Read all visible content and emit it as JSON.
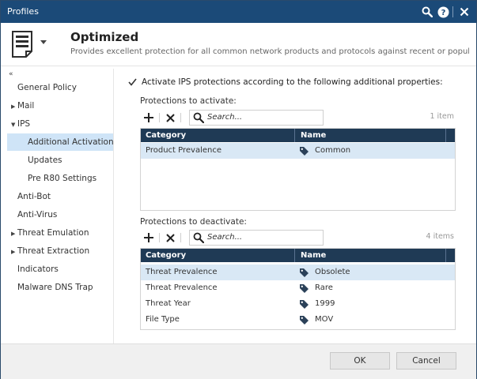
{
  "window": {
    "title": "Profiles",
    "icons": [
      "search-icon",
      "help-icon",
      "close-icon"
    ]
  },
  "profile": {
    "name": "Optimized",
    "description": "Provides excellent protection for all common network products and protocols against recent or popular attac..."
  },
  "sidebar": {
    "collapse_glyph": "«",
    "items": [
      {
        "label": "General Policy"
      },
      {
        "label": "Mail"
      },
      {
        "label": "IPS"
      },
      {
        "label": "Additional Activation"
      },
      {
        "label": "Updates"
      },
      {
        "label": "Pre R80 Settings"
      },
      {
        "label": "Anti-Bot"
      },
      {
        "label": "Anti-Virus"
      },
      {
        "label": "Threat Emulation"
      },
      {
        "label": "Threat Extraction"
      },
      {
        "label": "Indicators"
      },
      {
        "label": "Malware DNS Trap"
      }
    ]
  },
  "content": {
    "activate_checkbox": {
      "checked": true,
      "label": "Activate IPS protections according to the following additional properties:"
    },
    "activate_section": {
      "label": "Protections to activate:",
      "search_placeholder": "Search...",
      "count": "1 item",
      "columns": [
        "Category",
        "Name"
      ],
      "rows": [
        {
          "category": "Product Prevalence",
          "name": "Common",
          "selected": true
        }
      ]
    },
    "deactivate_section": {
      "label": "Protections to deactivate:",
      "search_placeholder": "Search...",
      "count": "4 items",
      "columns": [
        "Category",
        "Name"
      ],
      "rows": [
        {
          "category": "Threat Prevalence",
          "name": "Obsolete",
          "selected": true
        },
        {
          "category": "Threat Prevalence",
          "name": "Rare",
          "selected": false
        },
        {
          "category": "Threat Year",
          "name": "1999",
          "selected": false
        },
        {
          "category": "File Type",
          "name": "MOV",
          "selected": false
        }
      ]
    }
  },
  "footer": {
    "ok_label": "OK",
    "cancel_label": "Cancel"
  },
  "colors": {
    "titlebar": "#1b4a78",
    "table_header": "#1f3a55",
    "selection": "#cfe4f7",
    "row_selected": "#d9e8f5",
    "tag_icon": "#2b4159"
  }
}
